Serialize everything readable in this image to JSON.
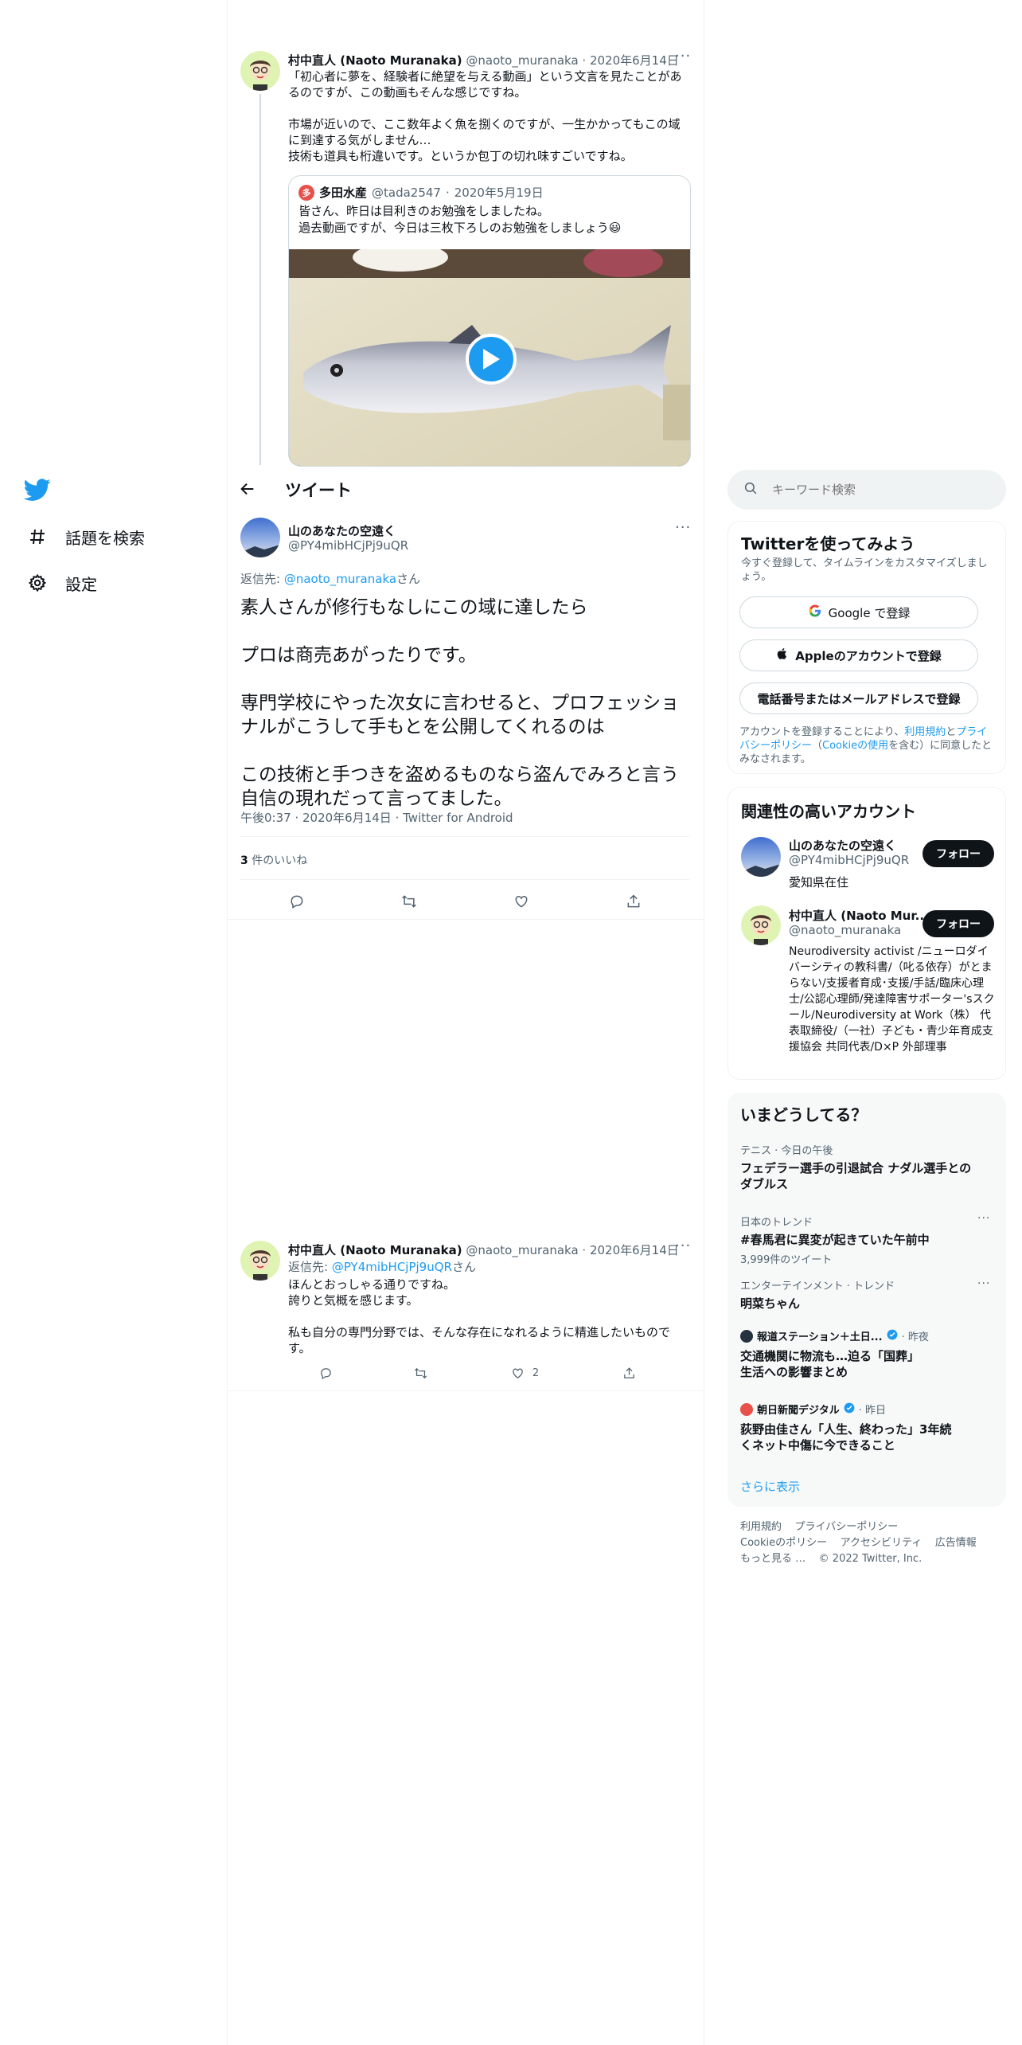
{
  "nav": {
    "items": [
      {
        "label": "話題を検索",
        "icon": "hashtag-icon"
      },
      {
        "label": "設定",
        "icon": "gear-icon"
      }
    ]
  },
  "tweet1": {
    "name": "村中直人 (Naoto Muranaka)",
    "handle": "@naoto_muranaka",
    "date": "2020年6月14日",
    "text": "「初心者に夢を、経験者に絶望を与える動画」という文言を見たことがあるのですが、この動画もそんな感じですね。\n\n市場が近いので、ここ数年よく魚を捌くのですが、一生かかってもこの域に到達する気がしません…\n技術も道具も桁違いです。というか包丁の切れ味すごいですね。",
    "quote": {
      "name": "多田水産",
      "handle": "@tada2547",
      "date": "2020年5月19日",
      "text": "皆さん、昨日は目利きのお勉強をしましたね。\n過去動画ですが、今日は三枚下ろしのお勉強をしましょう😃"
    }
  },
  "header": {
    "title": "ツイート"
  },
  "main_tweet": {
    "name": "山のあなたの空遠く",
    "handle": "@PY4mibHCjPj9uQR",
    "reply_to_prefix": "返信先: ",
    "reply_to_handle": "@naoto_muranaka",
    "reply_to_suffix": "さん",
    "text": "素人さんが修行もなしにこの域に達したら\n\nプロは商売あがったりです。\n\n専門学校にやった次女に言わせると、プロフェッショナルがこうして手もとを公開してくれるのは\n\nこの技術と手つきを盗めるものなら盗んでみろと言う自信の現れだって言ってました。",
    "time": "午後0:37",
    "date": "2020年6月14日",
    "client": "Twitter for Android",
    "likes_count": "3",
    "likes_label": " 件のいいね"
  },
  "reply_tweet": {
    "name": "村中直人 (Naoto Muranaka)",
    "handle": "@naoto_muranaka",
    "date": "2020年6月14日",
    "reply_to_prefix": "返信先: ",
    "reply_to_handle": "@PY4mibHCjPj9uQR",
    "reply_to_suffix": "さん",
    "text": "ほんとおっしゃる通りですね。\n誇りと気概を感じます。\n\n私も自分の専門分野では、そんな存在になれるように精進したいものです。",
    "like_count": "2"
  },
  "search": {
    "placeholder": "キーワード検索"
  },
  "signup": {
    "title": "Twitterを使ってみよう",
    "subtitle": "今すぐ登録して、タイムラインをカスタマイズしましょう。",
    "google": "Google で登録",
    "apple": "Appleのアカウントで登録",
    "phone": "電話番号またはメールアドレスで登録",
    "legal_1": "アカウントを登録することにより、",
    "legal_terms": "利用規約",
    "legal_2": "と",
    "legal_privacy": "プライバシーポリシー",
    "legal_3": "（",
    "legal_cookie": "Cookieの使用",
    "legal_4": "を含む）に同意したとみなされます。"
  },
  "relevant": {
    "title": "関連性の高いアカウント",
    "follow_label": "フォロー",
    "accounts": [
      {
        "name": "山のあなたの空遠く",
        "handle": "@PY4mibHCjPj9uQR",
        "bio": "愛知県在住"
      },
      {
        "name": "村中直人 (Naoto Mur...",
        "handle": "@naoto_muranaka",
        "bio": "Neurodiversity activist /ニューロダイバーシティの教科書/（叱る依存）がとまらない/支援者育成･支援/手話/臨床心理士/公認心理師/発達障害サポーター'sスクール/Neurodiversity at Work（株） 代表取締役/（一社）子ども・青少年育成支援協会 共同代表/D×P 外部理事"
      }
    ]
  },
  "trends": {
    "title": "いまどうしてる？",
    "items": [
      {
        "category": "テニス · 今日の午後",
        "title": "フェデラー選手の引退試合 ナダル選手とのダブルス"
      },
      {
        "category": "日本のトレンド",
        "title": "#春馬君に異変が起きていた午前中",
        "count": "3,999件のツイート"
      },
      {
        "category": "エンターテインメント · トレンド",
        "title": "明菜ちゃん"
      },
      {
        "source": "報道ステーション＋土日...",
        "when": "· 昨夜",
        "title": "交通機関に物流も…迫る「国葬」生活への影響まとめ"
      },
      {
        "source": "朝日新聞デジタル",
        "when": "· 昨日",
        "title": "荻野由佳さん「人生、終わった」3年続くネット中傷に今できること"
      }
    ],
    "show_more": "さらに表示"
  },
  "footer": {
    "terms": "利用規約",
    "privacy": "プライバシーポリシー",
    "cookie": "Cookieのポリシー",
    "accessibility": "アクセシビリティ",
    "ads": "広告情報",
    "more": "もっと見る …",
    "copyright": "© 2022 Twitter, Inc."
  },
  "colors": {
    "accent": "#1d9bf0",
    "text": "#0f1419",
    "muted": "#536471"
  }
}
